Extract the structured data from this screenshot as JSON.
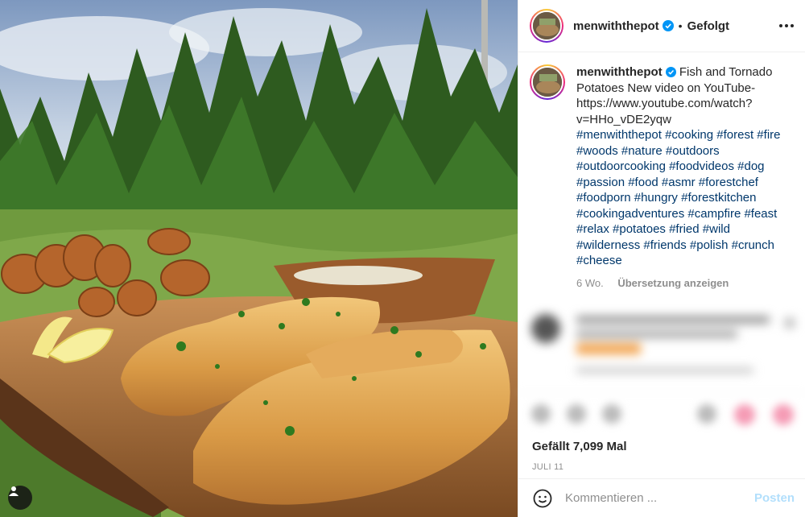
{
  "post": {
    "username": "menwiththepot",
    "follow_status": "Gefolgt",
    "caption_text": "Fish and Tornado Potatoes New video on YouTube- https://www.youtube.com/watch?v=HHo_vDE2yqw",
    "hashtags": "#menwiththepot #cooking #forest #fire #woods #nature #outdoors #outdoorcooking #foodvideos #dog #passion #food #asmr #forestchef #foodporn #hungry #forestkitchen #cookingadventures #campfire #feast #relax #potatoes #fried #wild #wilderness #friends #polish #crunch #cheese",
    "age": "6 Wo.",
    "translate_label": "Übersetzung anzeigen",
    "likes": "Gefällt 7,099 Mal",
    "date": "JULI 11"
  },
  "comment": {
    "placeholder": "Kommentieren ...",
    "post_label": "Posten"
  },
  "colors": {
    "link_blue": "#00376b",
    "verified_blue": "#0095f6",
    "post_button_disabled": "#b2dffc"
  },
  "icons": [
    "verified-badge-icon",
    "more-options-icon",
    "emoji-icon",
    "user-tag-icon"
  ]
}
